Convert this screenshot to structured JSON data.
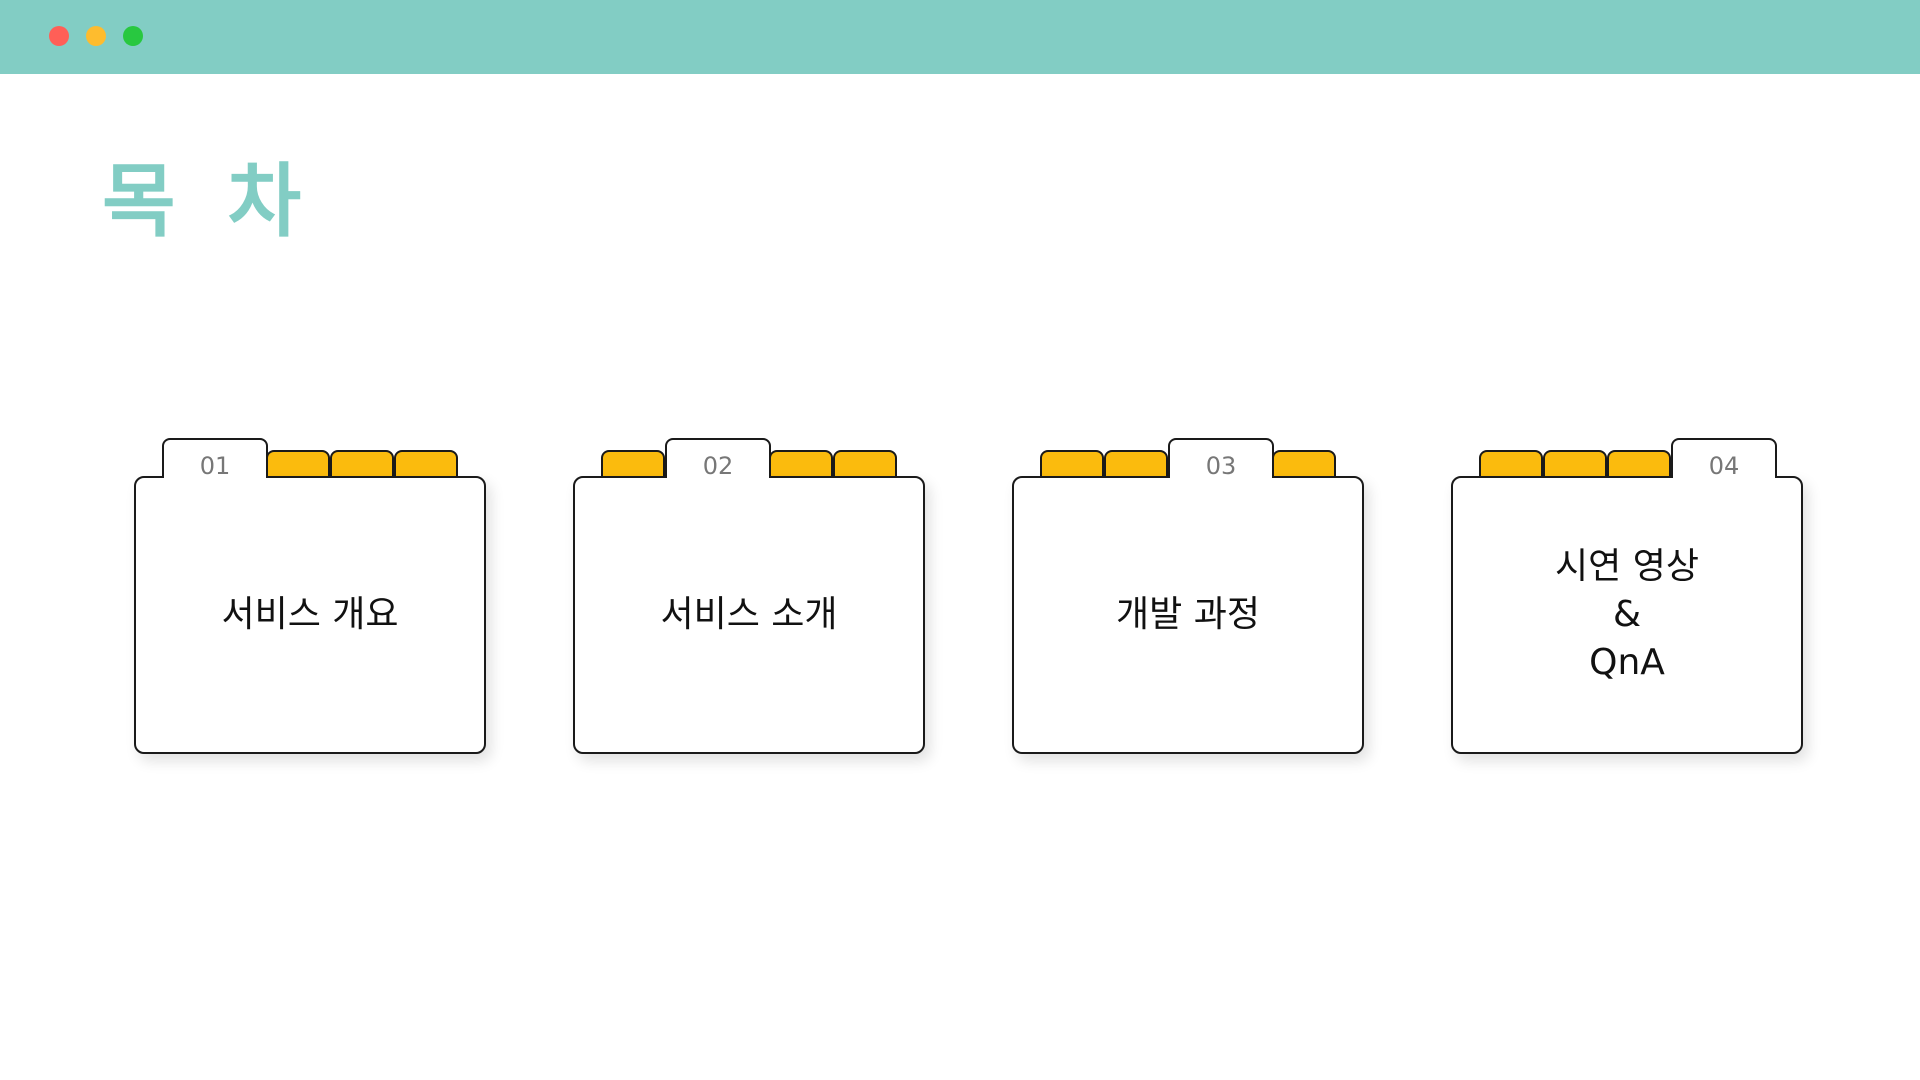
{
  "window": {
    "controls": [
      "close",
      "minimize",
      "maximize"
    ],
    "accent_color": "#82cdc4",
    "tab_color": "#fbbb0d"
  },
  "title": "목 차",
  "sections": [
    {
      "number": "01",
      "label_lines": [
        "서비스 개요"
      ]
    },
    {
      "number": "02",
      "label_lines": [
        "서비스 소개"
      ]
    },
    {
      "number": "03",
      "label_lines": [
        "개발 과정"
      ]
    },
    {
      "number": "04",
      "label_lines": [
        "시연 영상",
        "&",
        "QnA"
      ]
    }
  ]
}
